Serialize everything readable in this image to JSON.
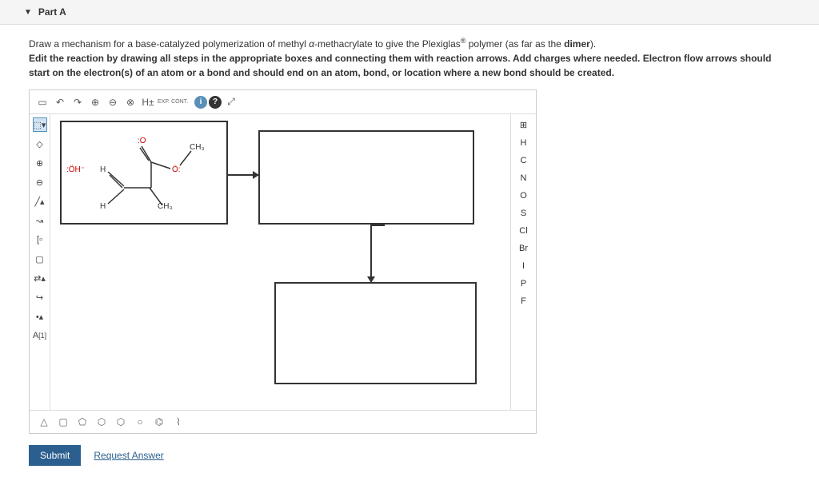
{
  "part": {
    "label": "Part A"
  },
  "instructions": {
    "line1_pre": "Draw a mechanism for a base-catalyzed polymerization of methyl ",
    "alpha": "α",
    "line1_post": "-methacrylate to give the Plexiglas",
    "reg": "®",
    "line1_end": " polymer (as far as the ",
    "dimer": "dimer",
    "line1_close": ").",
    "line2": "Edit the reaction by drawing all steps in the appropriate boxes and connecting them with reaction arrows. Add charges where needed. Electron flow arrows should start on the electron(s) of an atom or a bond and should end on an atom, bond, or location where a new bond should be created."
  },
  "toolbar": {
    "h_plus": "H±",
    "exp": "EXP.",
    "cont": "CONT."
  },
  "molecule": {
    "oh": ":ÖH⁻",
    "h1": "H",
    "h2": "H",
    "o1": ":O",
    "o2": "Ö:",
    "ch3_1": "CH₃",
    "ch3_2": "CH₃"
  },
  "elements": [
    "H",
    "C",
    "N",
    "O",
    "S",
    "Cl",
    "Br",
    "I",
    "P",
    "F"
  ],
  "left_tools": {
    "label_a": "A",
    "label_sup": "[1]"
  },
  "buttons": {
    "submit": "Submit",
    "request": "Request Answer"
  }
}
